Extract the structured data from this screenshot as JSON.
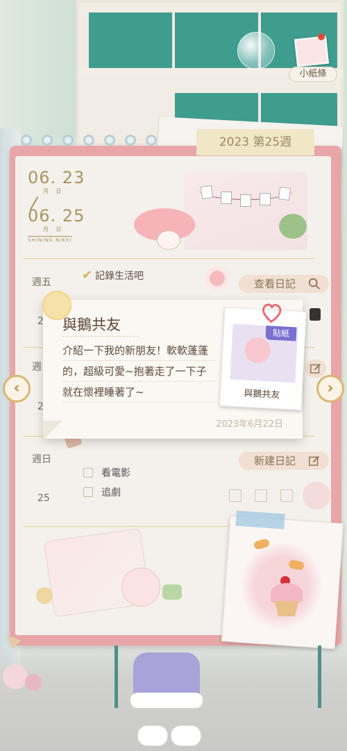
{
  "top_right": {
    "note_label": "小紙條"
  },
  "week_tab": "2023 第25週",
  "dates": {
    "start": "06. 23",
    "start_sub": "月 日",
    "end": "06. 25",
    "end_sub": "月 日",
    "brand": "SHINING NIKKI"
  },
  "days": [
    {
      "label": "週五",
      "num": "23",
      "action": "查看日記",
      "action_icon": "search-icon"
    },
    {
      "label": "週",
      "num": "2",
      "action": "",
      "action_icon": "edit-icon"
    },
    {
      "label": "週日",
      "num": "25",
      "action": "新建日記",
      "action_icon": "edit-icon"
    }
  ],
  "checklist": {
    "done": "記錄生活吧",
    "todo": [
      "看電影",
      "追劇"
    ]
  },
  "popup": {
    "title": "與鵝共友",
    "body": "介紹一下我的新朋友！軟軟蓬蓬的，超級可愛~抱著走了一下子就在懷裡睡著了~",
    "date": "2023年6月22日",
    "sticker_tag": "貼紙",
    "sticker_caption": "與鵝共友"
  },
  "nav": {
    "prev_symbol": "‹",
    "next_symbol": "›"
  },
  "colors": {
    "accent_gold": "#d9b675",
    "notebook_pink": "#e8a6a8",
    "sticker_purple": "#7b6fcf"
  }
}
